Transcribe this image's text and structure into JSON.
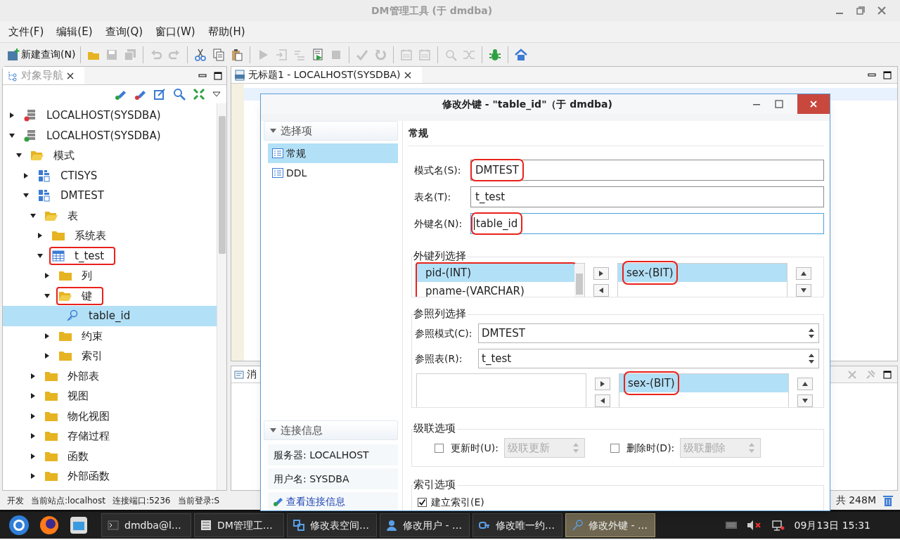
{
  "window": {
    "title": "DM管理工具 (于 dmdba)"
  },
  "menu": [
    "文件(F)",
    "编辑(E)",
    "查询(Q)",
    "窗口(W)",
    "帮助(H)"
  ],
  "toolbar": [
    {
      "kind": "new-query",
      "label": "新建查询(N)",
      "disabled": false
    },
    {
      "kind": "sep"
    },
    {
      "kind": "open",
      "disabled": false
    },
    {
      "kind": "save",
      "disabled": true
    },
    {
      "kind": "save-all",
      "disabled": true
    },
    {
      "kind": "sep"
    },
    {
      "kind": "undo",
      "disabled": true
    },
    {
      "kind": "redo",
      "disabled": true
    },
    {
      "kind": "sep"
    },
    {
      "kind": "cut",
      "disabled": false
    },
    {
      "kind": "copy",
      "disabled": false
    },
    {
      "kind": "paste",
      "disabled": false
    },
    {
      "kind": "sep"
    },
    {
      "kind": "run",
      "disabled": true
    },
    {
      "kind": "run-step",
      "disabled": true
    },
    {
      "kind": "run-next",
      "disabled": true
    },
    {
      "kind": "run-script",
      "disabled": false
    },
    {
      "kind": "stop",
      "disabled": true
    },
    {
      "kind": "sep"
    },
    {
      "kind": "commit",
      "disabled": true
    },
    {
      "kind": "rollback",
      "disabled": true
    },
    {
      "kind": "sep"
    },
    {
      "kind": "calendar",
      "disabled": true
    },
    {
      "kind": "calendar",
      "disabled": true
    },
    {
      "kind": "sep"
    },
    {
      "kind": "search",
      "disabled": true
    },
    {
      "kind": "shuffle",
      "disabled": true
    },
    {
      "kind": "sep"
    },
    {
      "kind": "bug",
      "disabled": false
    },
    {
      "kind": "sep"
    },
    {
      "kind": "home",
      "disabled": false
    }
  ],
  "navigator": {
    "title": "对象导航",
    "tree": [
      {
        "kind": "server",
        "label": "LOCALHOST(SYSDBA)",
        "color": "#d9363e",
        "expanded": false,
        "selected": false
      },
      {
        "kind": "server",
        "label": "LOCALHOST(SYSDBA)",
        "color": "#2ea043",
        "expanded": true,
        "selected": false,
        "children": [
          {
            "kind": "folder",
            "label": "模式",
            "expanded": true,
            "selected": false,
            "children": [
              {
                "kind": "schema",
                "label": "CTISYS",
                "expanded": false,
                "selected": false
              },
              {
                "kind": "schema",
                "label": "DMTEST",
                "expanded": true,
                "selected": false,
                "children": [
                  {
                    "kind": "folder",
                    "label": "表",
                    "expanded": true,
                    "selected": false,
                    "children": [
                      {
                        "kind": "folder",
                        "label": "系统表",
                        "expanded": false,
                        "selected": false
                      },
                      {
                        "kind": "table",
                        "label": "t_test",
                        "expanded": true,
                        "selected": false,
                        "annotated": true,
                        "children": [
                          {
                            "kind": "folder",
                            "label": "列",
                            "expanded": false,
                            "selected": false
                          },
                          {
                            "kind": "folder",
                            "label": "键",
                            "expanded": true,
                            "selected": false,
                            "annotated": true,
                            "children": [
                              {
                                "kind": "key",
                                "label": "table_id",
                                "selected": true
                              }
                            ]
                          },
                          {
                            "kind": "folder",
                            "label": "约束",
                            "expanded": false,
                            "selected": false
                          },
                          {
                            "kind": "folder",
                            "label": "索引",
                            "expanded": false,
                            "selected": false
                          }
                        ]
                      }
                    ]
                  },
                  {
                    "kind": "folder",
                    "label": "外部表",
                    "expanded": false,
                    "selected": false
                  },
                  {
                    "kind": "folder",
                    "label": "视图",
                    "expanded": false,
                    "selected": false
                  },
                  {
                    "kind": "folder",
                    "label": "物化视图",
                    "expanded": false,
                    "selected": false
                  },
                  {
                    "kind": "folder",
                    "label": "存储过程",
                    "expanded": false,
                    "selected": false
                  },
                  {
                    "kind": "folder",
                    "label": "函数",
                    "expanded": false,
                    "selected": false
                  },
                  {
                    "kind": "folder",
                    "label": "外部函数",
                    "expanded": false,
                    "selected": false
                  }
                ]
              }
            ]
          }
        ]
      }
    ]
  },
  "editor": {
    "tab": "无标题1 - LOCALHOST(SYSDBA)",
    "messages_tab": "消"
  },
  "dialog": {
    "title": "修改外键 - \"table_id\"（于 dmdba)",
    "sections": [
      {
        "title": "选择项",
        "items": [
          {
            "label": "常规",
            "selected": true
          },
          {
            "label": "DDL",
            "selected": false
          }
        ]
      }
    ],
    "connection": {
      "title": "连接信息",
      "server": "服务器: LOCALHOST",
      "user": "用户名: SYSDBA",
      "link": "查看连接信息"
    },
    "heading": "常规",
    "fields": [
      {
        "label": "模式名(S):",
        "value": "DMTEST",
        "focused": false,
        "annotated": true
      },
      {
        "label": "表名(T):",
        "value": "t_test",
        "focused": false
      },
      {
        "label": "外键名(N):",
        "value": "table_id",
        "focused": true,
        "annotated": true
      }
    ],
    "fk_columns": {
      "title": "外键列选择",
      "available": [
        {
          "label": "pid-(INT)",
          "selected": true
        },
        {
          "label": "pname-(VARCHAR)",
          "selected": false
        }
      ],
      "available_annotated": true,
      "chosen": [
        {
          "label": "sex-(BIT)",
          "selected": true,
          "annotated": true
        }
      ]
    },
    "ref_columns": {
      "title": "参照列选择",
      "schema_label": "参照模式(C):",
      "schema": "DMTEST",
      "table_label": "参照表(R):",
      "table": "t_test",
      "chosen": [
        {
          "label": "sex-(BIT)",
          "selected": true,
          "annotated": true
        }
      ]
    },
    "cascade": {
      "title": "级联选项",
      "update": {
        "label": "更新时(U):",
        "checked": false,
        "value": "级联更新"
      },
      "delete": {
        "label": "删除时(D):",
        "checked": false,
        "value": "级联删除"
      }
    },
    "index": {
      "title": "索引选项",
      "label": "建立索引(E)",
      "checked": true
    }
  },
  "status_bar": {
    "mode": "开发",
    "site": "当前站点:localhost",
    "port": "连接端口:5236",
    "login": "当前登录:S",
    "memory": "共 248M"
  },
  "taskbar": {
    "tasks": [
      {
        "kind": "terminal",
        "label": "dmdba@l…",
        "selected": false
      },
      {
        "kind": "app",
        "label": "DM管理工…",
        "selected": false
      },
      {
        "kind": "tablespace",
        "label": "修改表空间…",
        "selected": false
      },
      {
        "kind": "user",
        "label": "修改用户 - …",
        "selected": false
      },
      {
        "kind": "constraint",
        "label": "修改唯一约…",
        "selected": false
      },
      {
        "kind": "key",
        "label": "修改外键 - …",
        "selected": true
      }
    ],
    "clock": "09月13日 15:31"
  }
}
